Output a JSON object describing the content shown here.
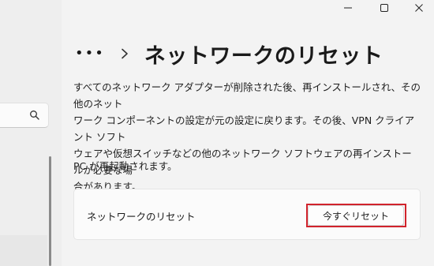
{
  "window": {
    "minimize_icon": "minimize-icon",
    "maximize_icon": "maximize-icon",
    "close_icon": "close-icon"
  },
  "sidebar": {
    "search_icon": "search-icon"
  },
  "breadcrumb": {
    "ellipsis": "•••",
    "separator_icon": "chevron-right-icon",
    "title": "ネットワークのリセット"
  },
  "content": {
    "description_line1": "すべてのネットワーク アダプターが削除された後、再インストールされ、その他のネット",
    "description_line2": "ワーク コンポーネントの設定が元の設定に戻ります。その後、VPN クライアント ソフト",
    "description_line3": "ウェアや仮想スイッチなどの他のネットワーク ソフトウェアの再インストールが必要な場",
    "description_line4": "合があります。",
    "restart_note": "PC が再起動されます。"
  },
  "reset_card": {
    "label": "ネットワークのリセット",
    "button_label": "今すぐリセット",
    "highlight_color": "#d1232c"
  }
}
